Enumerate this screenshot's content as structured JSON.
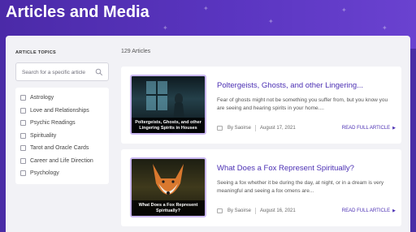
{
  "header": {
    "title": "Articles and Media"
  },
  "sidebar": {
    "heading": "ARTICLE TOPICS",
    "search_placeholder": "Search for a specific article",
    "topics": [
      "Astrology",
      "Love and Relationships",
      "Psychic Readings",
      "Spirituality",
      "Tarot and Oracle Cards",
      "Career and Life Direction",
      "Psychology"
    ]
  },
  "main": {
    "count_text": "129 Articles",
    "articles": [
      {
        "thumbnail_caption": "Poltergeists, Ghosts, and other Lingering Spirits in Houses",
        "title": "Poltergeists, Ghosts, and other Lingering...",
        "excerpt": "Fear of ghosts might not be something you suffer from, but you know you are seeing and hearing spirits in your home....",
        "author": "By Saoirse",
        "date": "August 17, 2021",
        "read_more": "READ FULL ARTICLE"
      },
      {
        "thumbnail_caption": "What Does a Fox Represent Spiritually?",
        "title": "What Does a Fox Represent Spiritually?",
        "excerpt": "Seeing a fox whether it be during the day, at night, or in a dream is very meaningful and seeing a fox omens are...",
        "author": "By Saoirse",
        "date": "August 16, 2021",
        "read_more": "READ FULL ARTICLE"
      }
    ]
  },
  "colors": {
    "accent": "#4b2fb3",
    "banner": "#4b2aa8",
    "panel": "#f2f2f6"
  }
}
